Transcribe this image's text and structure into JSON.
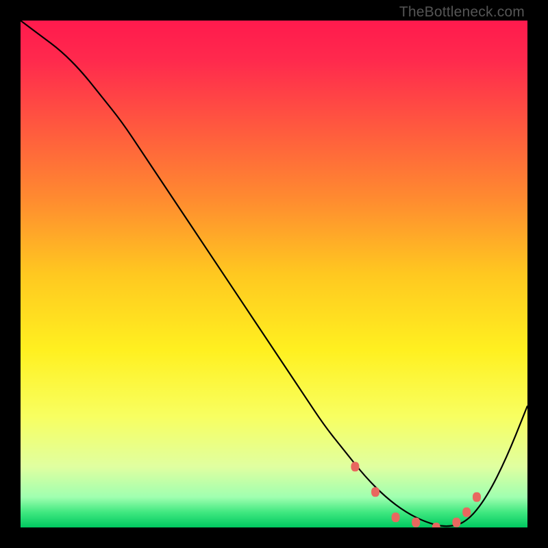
{
  "watermark": "TheBottleneck.com",
  "chart_data": {
    "type": "line",
    "title": "",
    "xlabel": "",
    "ylabel": "",
    "xlim": [
      0,
      100
    ],
    "ylim": [
      0,
      100
    ],
    "series": [
      {
        "name": "curve",
        "x": [
          0,
          4,
          8,
          12,
          16,
          20,
          24,
          28,
          32,
          36,
          40,
          44,
          48,
          52,
          56,
          60,
          64,
          68,
          72,
          76,
          80,
          84,
          88,
          92,
          96,
          100
        ],
        "values": [
          100,
          97,
          94,
          90,
          85,
          80,
          74,
          68,
          62,
          56,
          50,
          44,
          38,
          32,
          26,
          20,
          15,
          10,
          6,
          3,
          1,
          0,
          1,
          6,
          14,
          24
        ]
      }
    ],
    "markers": {
      "name": "highlight-points",
      "color": "#e8685f",
      "x": [
        66,
        70,
        74,
        78,
        82,
        86,
        88,
        90
      ],
      "values": [
        12,
        7,
        2,
        1,
        0,
        1,
        3,
        6
      ]
    },
    "background_gradient": {
      "stops": [
        {
          "pos": 0.0,
          "color": "#ff1a4d"
        },
        {
          "pos": 0.08,
          "color": "#ff2a4d"
        },
        {
          "pos": 0.2,
          "color": "#ff5540"
        },
        {
          "pos": 0.35,
          "color": "#ff8a30"
        },
        {
          "pos": 0.5,
          "color": "#ffc820"
        },
        {
          "pos": 0.65,
          "color": "#fff020"
        },
        {
          "pos": 0.78,
          "color": "#f8ff60"
        },
        {
          "pos": 0.88,
          "color": "#e0ffa0"
        },
        {
          "pos": 0.94,
          "color": "#a0ffb0"
        },
        {
          "pos": 0.97,
          "color": "#40e880"
        },
        {
          "pos": 1.0,
          "color": "#00c860"
        }
      ]
    }
  }
}
